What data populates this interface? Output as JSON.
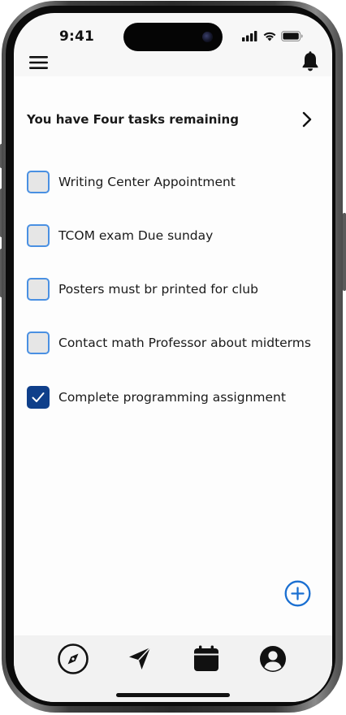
{
  "status_bar": {
    "time": "9:41",
    "icons": [
      "cellular-signal-icon",
      "wifi-icon",
      "battery-icon"
    ]
  },
  "header": {
    "menu_icon": "hamburger-menu-icon",
    "notification_icon": "bell-icon"
  },
  "summary": {
    "text": "You have Four tasks remaining",
    "action_icon": "chevron-right-icon"
  },
  "tasks": [
    {
      "label": "Writing Center Appointment",
      "checked": false
    },
    {
      "label": "TCOM exam Due sunday",
      "checked": false
    },
    {
      "label": "Posters must br printed for club",
      "checked": false
    },
    {
      "label": "Contact math Professor about midterms",
      "checked": false
    },
    {
      "label": "Complete programming assignment",
      "checked": true
    }
  ],
  "add_button": {
    "icon": "plus-circle-icon"
  },
  "tab_bar": {
    "items": [
      {
        "icon": "compass-icon"
      },
      {
        "icon": "send-icon"
      },
      {
        "icon": "calendar-icon"
      },
      {
        "icon": "profile-icon"
      }
    ]
  },
  "colors": {
    "accent": "#1a6fd1",
    "checked_fill": "#0f3f8a",
    "checkbox_border": "#4a90e2",
    "background": "#fdfdfd",
    "tab_bar_background": "#f2f2f2"
  }
}
